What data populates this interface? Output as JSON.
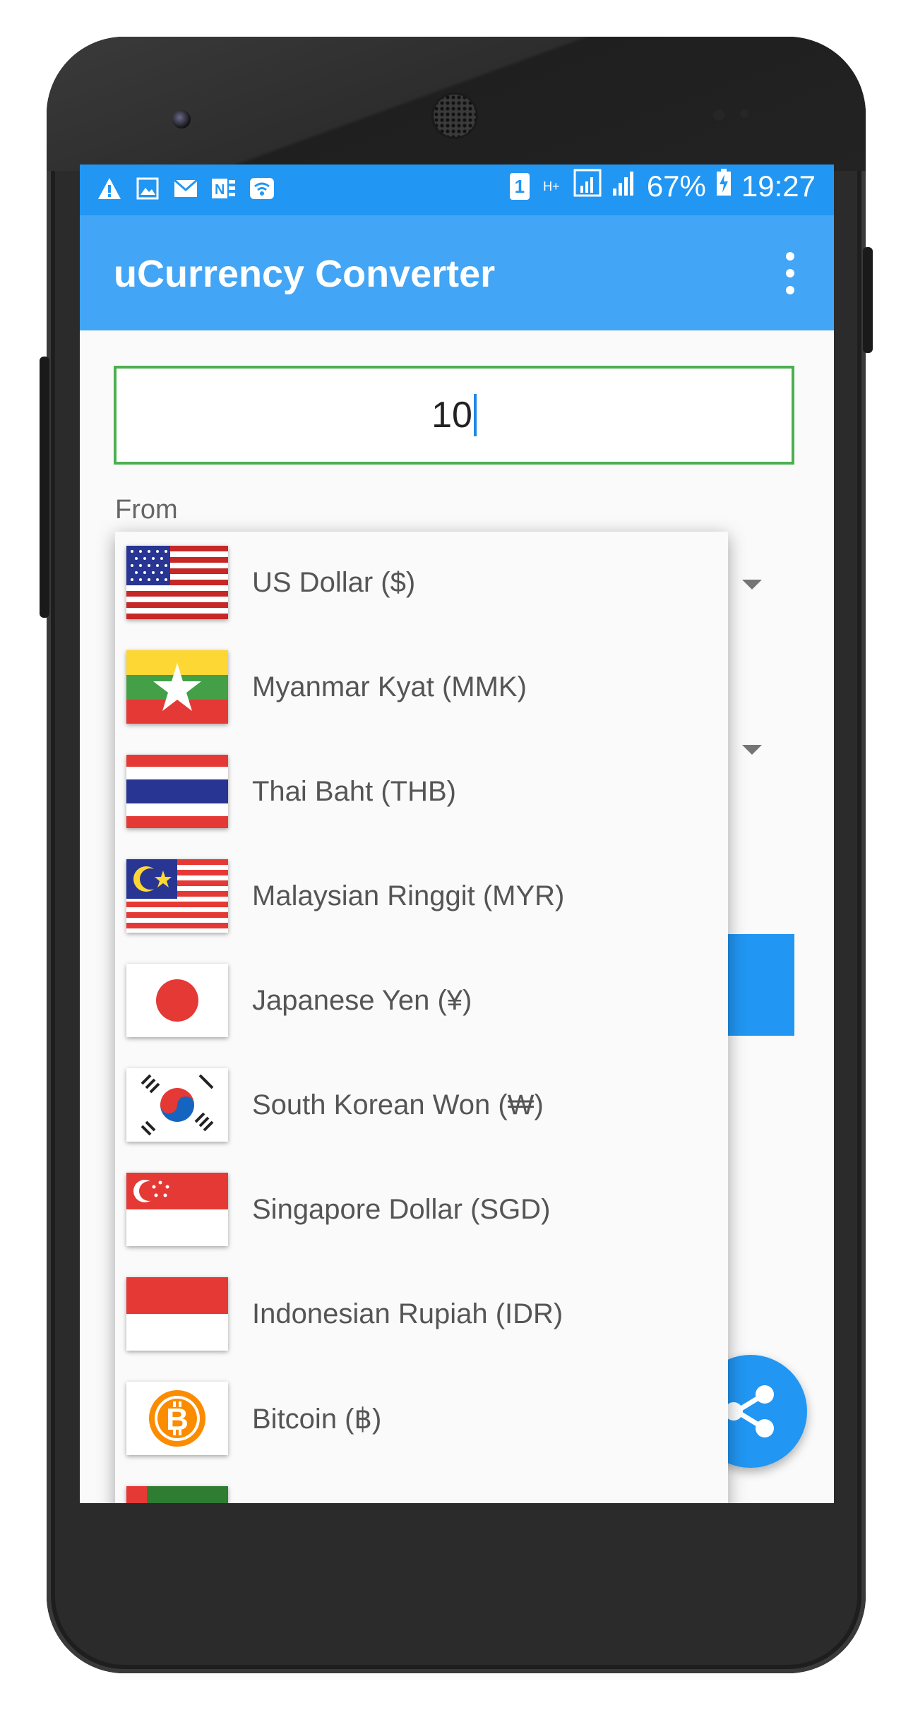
{
  "statusbar": {
    "battery": "67%",
    "time": "19:27",
    "sim": "1",
    "net": "H+"
  },
  "app": {
    "title": "uCurrency Converter"
  },
  "amount": {
    "value": "10"
  },
  "from": {
    "label": "From"
  },
  "dropdown": {
    "items": [
      {
        "label": "US Dollar ($)",
        "flag": "us-flag"
      },
      {
        "label": "Myanmar Kyat (MMK)",
        "flag": "myanmar-flag"
      },
      {
        "label": "Thai Baht (THB)",
        "flag": "thailand-flag"
      },
      {
        "label": "Malaysian Ringgit (MYR)",
        "flag": "malaysia-flag"
      },
      {
        "label": "Japanese Yen (¥)",
        "flag": "japan-flag"
      },
      {
        "label": "South Korean Won (₩)",
        "flag": "south-korea-flag"
      },
      {
        "label": "Singapore Dollar (SGD)",
        "flag": "singapore-flag"
      },
      {
        "label": "Indonesian Rupiah (IDR)",
        "flag": "indonesia-flag"
      },
      {
        "label": "Bitcoin (฿)",
        "flag": "bitcoin-icon"
      }
    ]
  },
  "colors": {
    "primary": "#2196f3",
    "toolbar": "#42a5f5",
    "input_border": "#4caf50"
  }
}
